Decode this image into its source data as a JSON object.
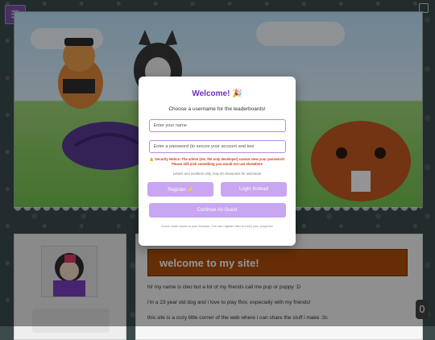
{
  "page": {
    "menu_icon": "hamburger-icon",
    "counter": "0"
  },
  "main": {
    "heading": "welcome to my site!",
    "paragraphs": [
      "hi! my name is cleo but a lot of my friends call me pup or puppy :D",
      "i'm a 23 year old dog and i love to play ffxiv, especially with my friends!",
      "this site is a cozy little corner of the web where i can share the stuff i make :3c"
    ]
  },
  "modal": {
    "title": "Welcome! 🎉",
    "subtitle": "Choose a username for the leaderboards!",
    "username_placeholder": "Enter your name",
    "password_placeholder": "Enter a password (to secure your account and kee",
    "security_notice": "⚠️ Security Notice: The admin (me, the only developer) cannot view your password! Please still pick something you would not use elsewhere",
    "hint": "Letters and numbers only, max 20 characters for username",
    "register_label": "Register ✨",
    "login_label": "Login Instead",
    "guest_label": "Continue As Guest",
    "fine_print": "Guest mode saves to your browser. You can register later to keep your progress!"
  },
  "colors": {
    "accent": "#6b2fbf",
    "button": "#c8a6f2",
    "header": "#b0500d"
  }
}
